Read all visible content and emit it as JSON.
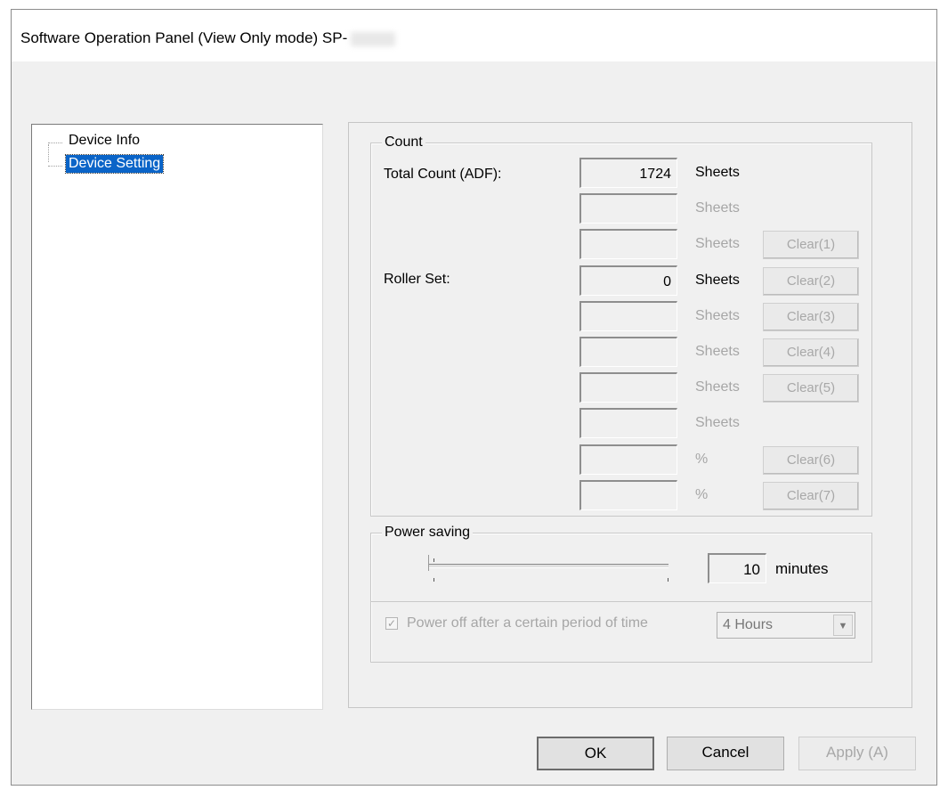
{
  "window": {
    "title": "Software Operation Panel (View Only mode) SP-"
  },
  "tree": {
    "items": [
      {
        "label": "Device Info",
        "selected": false
      },
      {
        "label": "Device Setting",
        "selected": true
      }
    ]
  },
  "count": {
    "legend": "Count",
    "total_label": "Total Count (ADF):",
    "roller_label": "Roller Set:",
    "rows": [
      {
        "value": "1724",
        "unit": "Sheets",
        "unit_enabled": true,
        "clear": ""
      },
      {
        "value": "",
        "unit": "Sheets",
        "unit_enabled": false,
        "clear": ""
      },
      {
        "value": "",
        "unit": "Sheets",
        "unit_enabled": false,
        "clear": "Clear(1)"
      },
      {
        "value": "0",
        "unit": "Sheets",
        "unit_enabled": true,
        "clear": "Clear(2)"
      },
      {
        "value": "",
        "unit": "Sheets",
        "unit_enabled": false,
        "clear": "Clear(3)"
      },
      {
        "value": "",
        "unit": "Sheets",
        "unit_enabled": false,
        "clear": "Clear(4)"
      },
      {
        "value": "",
        "unit": "Sheets",
        "unit_enabled": false,
        "clear": "Clear(5)"
      },
      {
        "value": "",
        "unit": "Sheets",
        "unit_enabled": false,
        "clear": ""
      },
      {
        "value": "",
        "unit": "%",
        "unit_enabled": false,
        "clear": "Clear(6)"
      },
      {
        "value": "",
        "unit": "%",
        "unit_enabled": false,
        "clear": "Clear(7)"
      }
    ]
  },
  "power": {
    "legend": "Power saving",
    "slider_level": 0,
    "minutes_value": "10",
    "minutes_unit": "minutes",
    "power_off_label": "Power off after a certain period of time",
    "power_off_checked": true,
    "power_off_enabled": false,
    "hours_value": "4 Hours"
  },
  "buttons": {
    "ok": "OK",
    "cancel": "Cancel",
    "apply": "Apply (A)"
  },
  "icons": {
    "checkmark": "check-icon",
    "dropdown": "chevron-down-icon"
  }
}
